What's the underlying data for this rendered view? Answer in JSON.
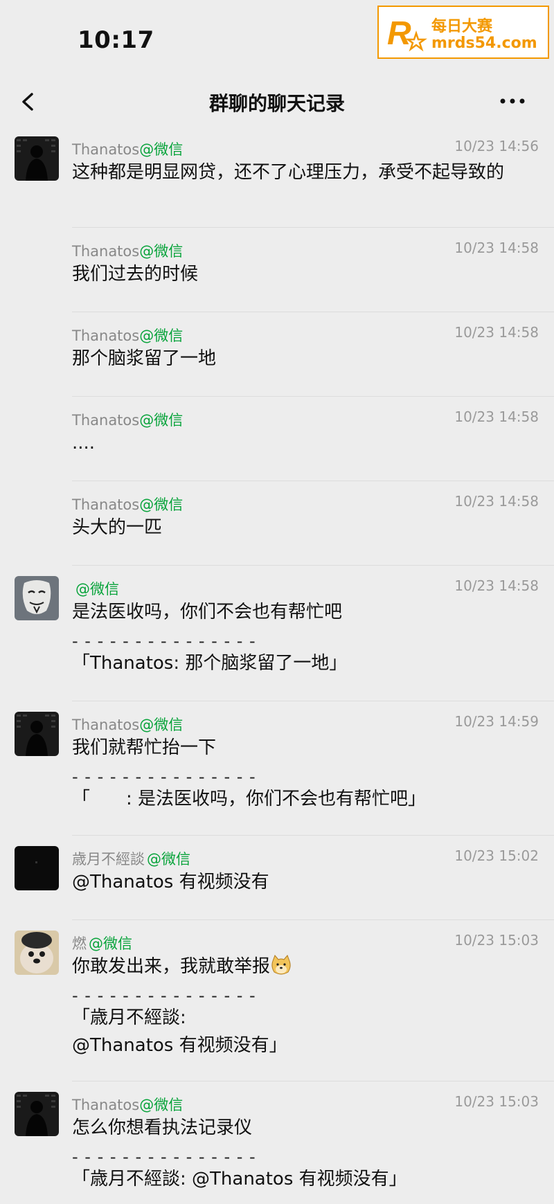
{
  "status_bar": {
    "time": "10:17"
  },
  "watermark": {
    "line1": "每日大赛",
    "line2": "mrds54.com",
    "logo_letter": "R"
  },
  "nav": {
    "title": "群聊的聊天记录",
    "back_icon": "chevron-left-icon",
    "more_icon": "more-dots-icon"
  },
  "colors": {
    "background": "#ededed",
    "wechat_green": "#07a33a",
    "watermark_orange": "#f39800"
  },
  "messages": [
    {
      "name": "Thanatos",
      "at": "@微信",
      "time": "10/23 14:56",
      "text": "这种都是明显网贷，还不了心理压力，承受不起导致的"
    },
    {
      "name": "Thanatos",
      "at": "@微信",
      "time": "10/23 14:58",
      "text": "我们过去的时候"
    },
    {
      "name": "Thanatos",
      "at": "@微信",
      "time": "10/23 14:58",
      "text": "那个脑浆留了一地"
    },
    {
      "name": "Thanatos",
      "at": "@微信",
      "time": "10/23 14:58",
      "text": "...."
    },
    {
      "name": "Thanatos",
      "at": "@微信",
      "time": "10/23 14:58",
      "text": "头大的一匹"
    },
    {
      "name": "",
      "at": "@微信",
      "time": "10/23 14:58",
      "text": "是法医收吗，你们不会也有帮忙吧",
      "divider": "- - - - - - - - - - - - - - -",
      "quote": "「Thanatos: 那个脑浆留了一地」"
    },
    {
      "name": "Thanatos",
      "at": "@微信",
      "time": "10/23 14:59",
      "text": "我们就帮忙抬一下",
      "divider": "- - - - - - - - - - - - - - -",
      "quote": "「　　: 是法医收吗，你们不会也有帮忙吧」"
    },
    {
      "name": "歳月不經談",
      "at": "@微信",
      "time": "10/23 15:02",
      "text": "@Thanatos 有视频没有"
    },
    {
      "name": "燃",
      "at": "@微信",
      "time": "10/23 15:03",
      "text": "你敢发出来，我就敢举报",
      "divider": "- - - - - - - - - - - - - - -",
      "quote": "「歳月不經談:",
      "quote2": "@Thanatos 有视频没有」"
    },
    {
      "name": "Thanatos",
      "at": "@微信",
      "time": "10/23 15:03",
      "text": "怎么你想看执法记录仪",
      "divider": "- - - - - - - - - - - - - - -",
      "quote": "「歳月不經談: @Thanatos 有视频没有」"
    }
  ]
}
